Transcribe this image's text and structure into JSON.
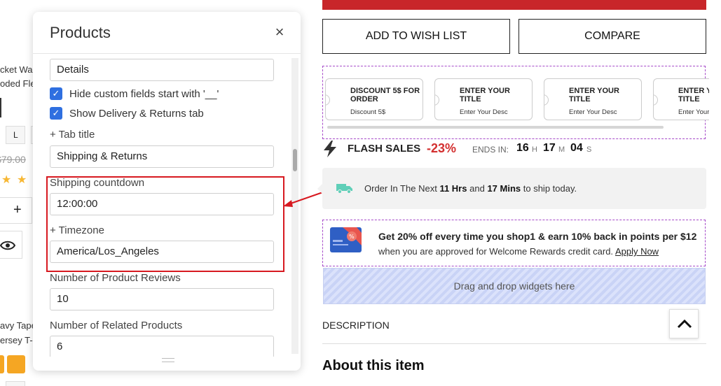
{
  "background": {
    "texts": [
      "cket War",
      "oded Flee",
      "L",
      "$79.00",
      "+",
      "avy Tape",
      "ersey T-"
    ]
  },
  "panel": {
    "title": "Products",
    "close_glyph": "×",
    "details_value": "Details",
    "hide_custom_label": "Hide custom fields start with '__'",
    "show_delivery_label": "Show Delivery & Returns tab",
    "tab_title_label": "+ Tab title",
    "tab_title_value": "Shipping & Returns",
    "shipping_countdown_label": "Shipping countdown",
    "shipping_countdown_value": "12:00:00",
    "timezone_label": "+ Timezone",
    "timezone_value": "America/Los_Angeles",
    "reviews_label": "Number of Product Reviews",
    "reviews_value": "10",
    "related_label": "Number of Related Products",
    "related_value": "6"
  },
  "buttons": {
    "wishlist": "ADD TO WISH LIST",
    "compare": "COMPARE"
  },
  "coupons": [
    {
      "title": "DISCOUNT 5$ FOR ORDER",
      "desc": "Discount 5$"
    },
    {
      "title": "ENTER YOUR TITLE",
      "desc": "Enter Your Desc"
    },
    {
      "title": "ENTER YOUR TITLE",
      "desc": "Enter Your Desc"
    },
    {
      "title": "ENTER YOUR TITLE",
      "desc": "Enter Your Desc"
    }
  ],
  "flash": {
    "label": "FLASH SALES",
    "percent": "-23%",
    "ends_in": "ENDS IN:",
    "hours": "16",
    "hours_unit": "H",
    "minutes": "17",
    "minutes_unit": "M",
    "seconds": "04",
    "seconds_unit": "S"
  },
  "shipping": {
    "prefix": "Order In The Next",
    "hours": "11 Hrs",
    "and": "and",
    "mins": "17 Mins",
    "suffix": "to ship today."
  },
  "promo": {
    "title": "Get 20% off every time you shop1 & earn 10% back in points per $12",
    "sub": "when you are approved for Welcome Rewards credit card.",
    "link": "Apply Now"
  },
  "drop_zone": "Drag and drop widgets here",
  "description": "DESCRIPTION",
  "about": "About this item",
  "colors": {
    "accent_red": "#c8262a",
    "checkbox_blue": "#2f6fe0",
    "promo_border": "#a64ac9",
    "truck_green": "#5fcfb8",
    "discount_red": "#d32f2f"
  }
}
